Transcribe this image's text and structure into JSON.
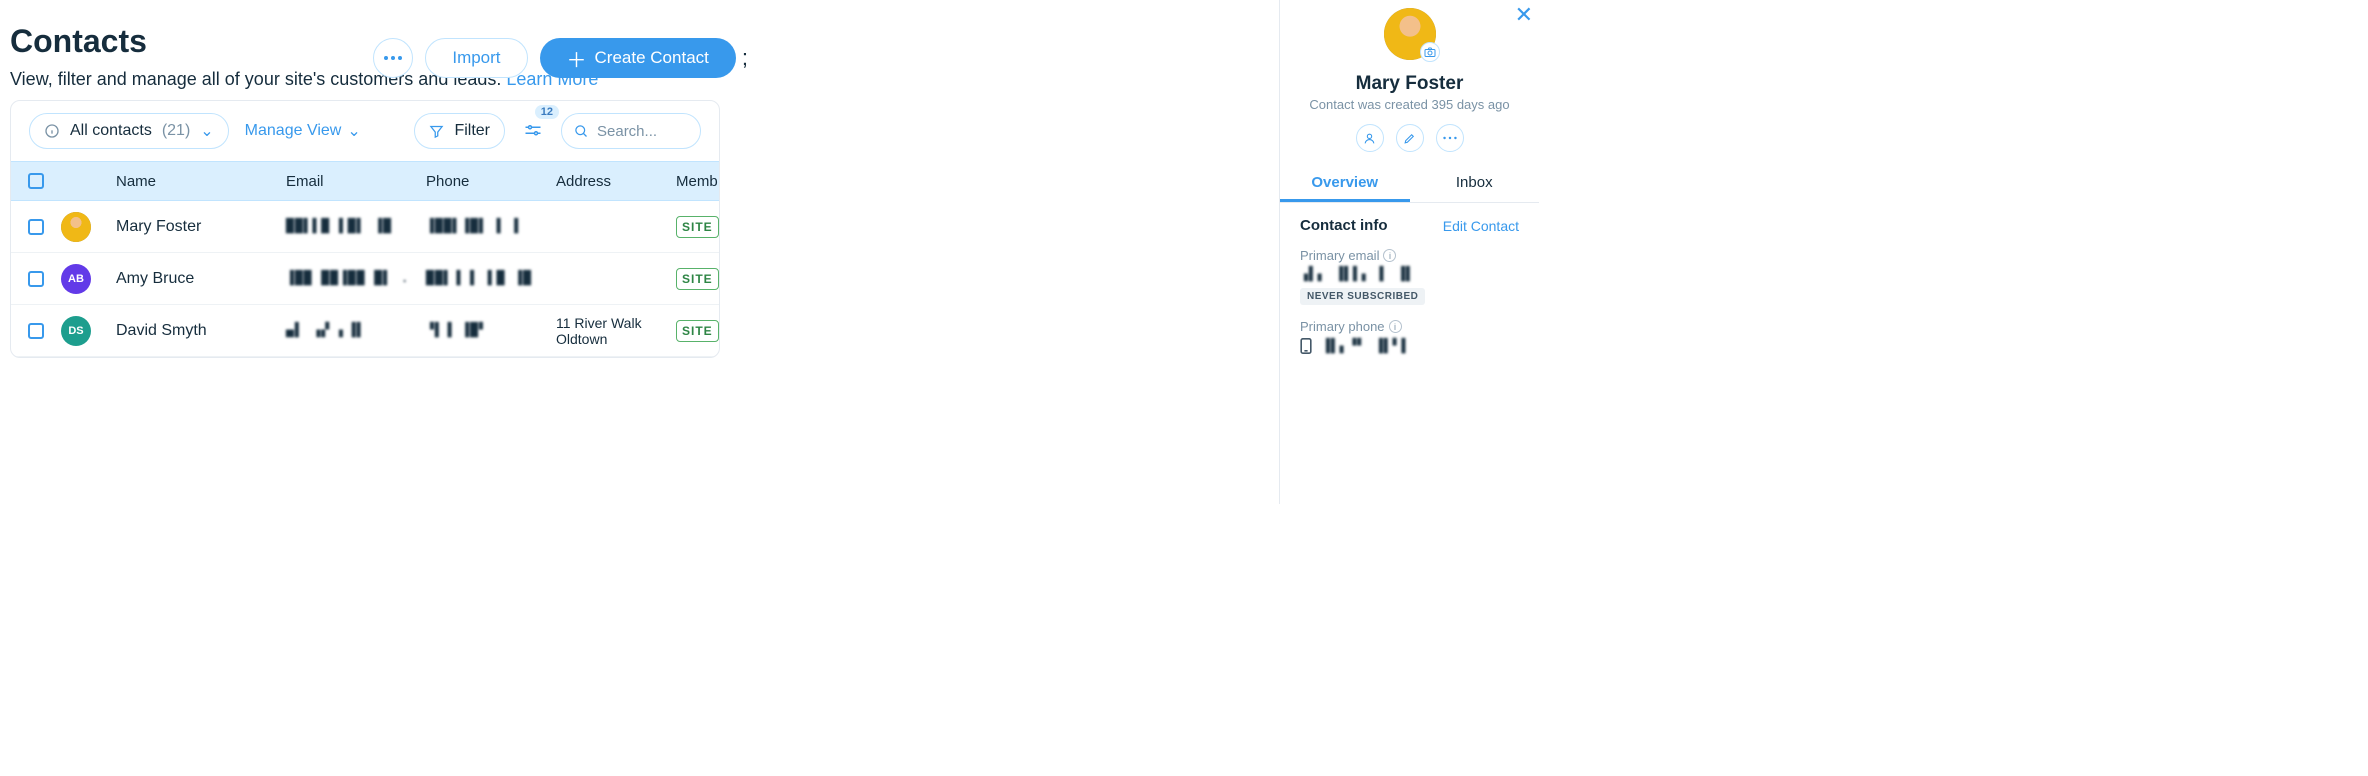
{
  "header": {
    "title": "Contacts",
    "subtitle_prefix": "View, filter and manage all of your site's customers and leads. ",
    "learn_more": "Learn More",
    "more_label": "More options",
    "import_label": "Import",
    "create_label": "Create Contact",
    "trailing_semicolon": ";"
  },
  "toolbar": {
    "scope_label": "All contacts",
    "scope_count": "(21)",
    "manage_view": "Manage View",
    "filter_label": "Filter",
    "adjust_badge": "12",
    "search_placeholder": "Search..."
  },
  "columns": {
    "name": "Name",
    "email": "Email",
    "phone": "Phone",
    "address": "Address",
    "member": "Memb"
  },
  "rows": [
    {
      "name": "Mary Foster",
      "email_masked": "██▌▌█ ▌█▌ ▐█",
      "phone_masked": "▐██▌▐█▌  ▌ ▌",
      "address": "",
      "initials": "",
      "avatar_class": "photo",
      "tag": "SITE"
    },
    {
      "name": "Amy Bruce",
      "email_masked": "▐██ ██▐██ █▌ .",
      "phone_masked": "██▌▐ ▌ ▌█ ▐█",
      "address": "",
      "initials": "AB",
      "avatar_class": "ab",
      "tag": "SITE"
    },
    {
      "name": "David Smyth",
      "email_masked": "▄▌ ▗▞ ▖▐▌",
      "phone_masked": "▝▌▐  ▐█▘",
      "address": "11 River Walk Oldtown",
      "initials": "DS",
      "avatar_class": "ds",
      "tag": "SITE"
    }
  ],
  "panel": {
    "contact_name": "Mary Foster",
    "created_line": "Contact was created 395 days ago",
    "tabs": {
      "overview": "Overview",
      "inbox": "Inbox"
    },
    "section_title": "Contact info",
    "edit_label": "Edit Contact",
    "primary_email_label": "Primary email",
    "primary_email_value": "▗▌▖ ▐▌▌▖ ▌ ▐▌",
    "subscription_badge": "NEVER SUBSCRIBED",
    "primary_phone_label": "Primary phone",
    "primary_phone_value": "▐▌▖▝▘ ▐▌▘▌"
  }
}
